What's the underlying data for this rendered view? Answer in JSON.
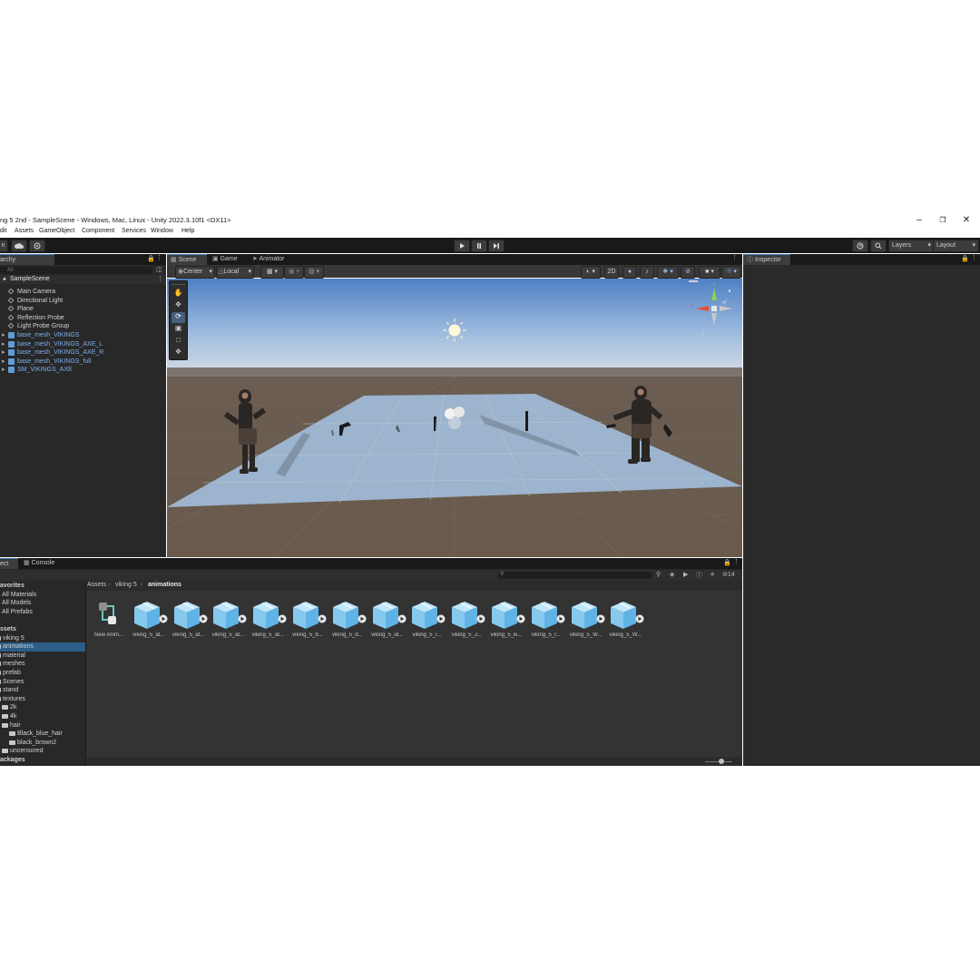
{
  "window": {
    "title": "ng 5 2nd - SampleScene - Windows, Mac, Linux - Unity 2022.3.10f1 <DX11>",
    "minimize_icon": "minimize-icon",
    "maximize_icon": "restore-icon",
    "close_icon": "close-icon"
  },
  "menu": [
    "dit",
    "Assets",
    "GameObject",
    "Component",
    "Services",
    "Window",
    "Help"
  ],
  "toolbar": {
    "left_btn": "n",
    "layers_label": "Layers",
    "layout_label": "Layout"
  },
  "hierarchy": {
    "tab_label": "archy",
    "search_placeholder": "All",
    "scene_name": "SampleScene",
    "items": [
      {
        "label": "Main Camera",
        "kind": "object"
      },
      {
        "label": "Directional Light",
        "kind": "object"
      },
      {
        "label": "Plane",
        "kind": "object"
      },
      {
        "label": "Reflection Probe",
        "kind": "object"
      },
      {
        "label": "Light Probe Group",
        "kind": "object"
      },
      {
        "label": "base_mesh_VIKINGS",
        "kind": "prefab"
      },
      {
        "label": "base_mesh_VIKINGS_AXE_L",
        "kind": "prefab"
      },
      {
        "label": "base_mesh_VIKINGS_AXE_R",
        "kind": "prefab"
      },
      {
        "label": "base_mesh_VIKINGS_full",
        "kind": "prefab"
      },
      {
        "label": "SM_VIKINGS_AXE",
        "kind": "prefab"
      }
    ]
  },
  "scene_tabs": [
    "Scene",
    "Game",
    "Animator"
  ],
  "scene_toolbar": {
    "pivot": "Center",
    "space": "Local",
    "mode_2d": "2D"
  },
  "inspector": {
    "tab_label": "Inspector"
  },
  "bottom_tabs": [
    "ect",
    "Console"
  ],
  "project": {
    "favorites_header": "avorites",
    "favorites": [
      "All Materials",
      "All Models",
      "All Prefabs"
    ],
    "assets_header": "ssets",
    "folders": [
      {
        "label": "viking 5",
        "indent": 0
      },
      {
        "label": "animations",
        "indent": 0,
        "selected": true
      },
      {
        "label": "material",
        "indent": 0
      },
      {
        "label": "meshes",
        "indent": 0
      },
      {
        "label": "prefab",
        "indent": 0
      },
      {
        "label": "Scenes",
        "indent": 0
      },
      {
        "label": "stand",
        "indent": 0
      },
      {
        "label": "textures",
        "indent": 0
      },
      {
        "label": "2k",
        "indent": 1
      },
      {
        "label": "4k",
        "indent": 1
      },
      {
        "label": "hair",
        "indent": 1
      },
      {
        "label": "Black_blue_hair",
        "indent": 2
      },
      {
        "label": "black_brown2",
        "indent": 2
      },
      {
        "label": "uncensored",
        "indent": 1
      }
    ],
    "packages_header": "ackages",
    "breadcrumb": [
      "Assets",
      "viking 5",
      "animations"
    ],
    "hidden_count": "14",
    "assets": [
      "New Anim...",
      "viking_5_at...",
      "viking_5_at...",
      "viking_5_at...",
      "viking_5_at...",
      "viking_5_b...",
      "viking_5_d...",
      "viking_5_id...",
      "viking_5_i...",
      "viking_5_J...",
      "viking_5_ki...",
      "viking_5_r...",
      "viking_5_W...",
      "viking_5_W..."
    ]
  }
}
